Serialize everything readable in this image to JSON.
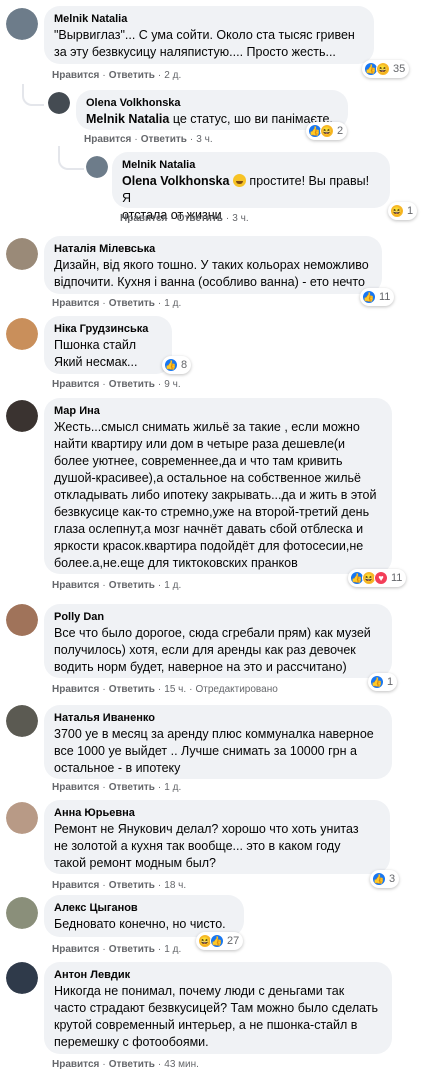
{
  "labels": {
    "like": "Нравится",
    "reply": "Ответить"
  },
  "comments": [
    {
      "name": "Melnik Natalia",
      "text": "\"Вырвиглаз\"... С ума сойти. Около ста тысяс гривен\nза эту безвкусицу наляпистую.... Просто жесть...",
      "time": "2 д.",
      "reactions": "35",
      "avatar_color": "#6d7c8a"
    },
    {
      "name": "Olena Volkhonska",
      "mention": "Melnik Natalia",
      "text": "це статус, шо ви панімаєте.",
      "time": "3 ч.",
      "reactions": "2",
      "avatar_color": "#444b52"
    },
    {
      "name": "Melnik Natalia",
      "mention": "Olena Volkhonska",
      "text": "простите! Вы правы! Я\nотстала от жизни",
      "time": "3 ч.",
      "reactions": "1",
      "avatar_color": "#6d7c8a"
    },
    {
      "name": "Наталія Мілевська",
      "text": "Дизайн, від якого тошно. У таких кольорах неможливо\nвідпочити. Кухня і ванна (особливо ванна) - ето нечто",
      "time": "1 д.",
      "reactions": "11",
      "avatar_color": "#9a8a78"
    },
    {
      "name": "Ніка Грудзинська",
      "text": "Пшонка стайл\nЯкий несмак...",
      "time": "9 ч.",
      "reactions": "8",
      "avatar_color": "#c98f5b"
    },
    {
      "name": "Мар Ина",
      "text": "Жесть...смысл снимать жильё за такие      , если можно\nнайти квартиру или дом в четыре раза дешевле(и\nболее уютнее, современнее,да и что там кривить\nдушой-красивее),а остальное на собственное жильё\nоткладывать либо ипотеку закрывать...да и жить в этой\nбезвкусице как-то стремно,уже на второй-третий день\nглаза ослепнут,а мозг начнёт давать сбой отблеска и\nяркости красок.квартира подойдёт для фотосесии,не\nболее.а,не.еще для тиктоковских пранков",
      "time": "1 д.",
      "reactions": "11",
      "avatar_color": "#3a3330"
    },
    {
      "name": "Polly Dan",
      "text": "Все что было дорогое, сюда сгребали прям) как музей\nполучилось) хотя, если для аренды как раз девочек\nводить норм будет, наверное на это и рассчитано)",
      "time": "15 ч.",
      "edited": "Отредактировано",
      "reactions": "1",
      "avatar_color": "#a0735a"
    },
    {
      "name": "Наталья Иваненко",
      "text": "3700 уе в месяц за аренду плюс коммуналка наверное\nвсе 1000 уе выйдет .. Лучше снимать за 10000 грн а\nостальное - в ипотеку",
      "time": "1 д.",
      "reactions": "",
      "avatar_color": "#5b5a52"
    },
    {
      "name": "Анна Юрьевна",
      "text": "Ремонт не Янукович делал?   хорошо что хоть унитаз\nне золотой      а кухня так вообще... это в каком году\nтакой ремонт модным был?",
      "time": "18 ч.",
      "reactions": "3",
      "avatar_color": "#b89a86"
    },
    {
      "name": "Алекс Цыганов",
      "text": "Бедновато конечно, но чисто.",
      "time": "1 д.",
      "reactions": "27",
      "avatar_color": "#8a8f7a"
    },
    {
      "name": "Антон Левдик",
      "text": "Никогда не понимал, почему люди с деньгами так\nчасто страдают безвкусицей? Там можно было сделать\nкрутой современный интерьер, а не пшонка-стайл в\nперемешку с фотообоями.",
      "time": "43 мин.",
      "reactions": "",
      "avatar_color": "#2f3a4a"
    }
  ]
}
